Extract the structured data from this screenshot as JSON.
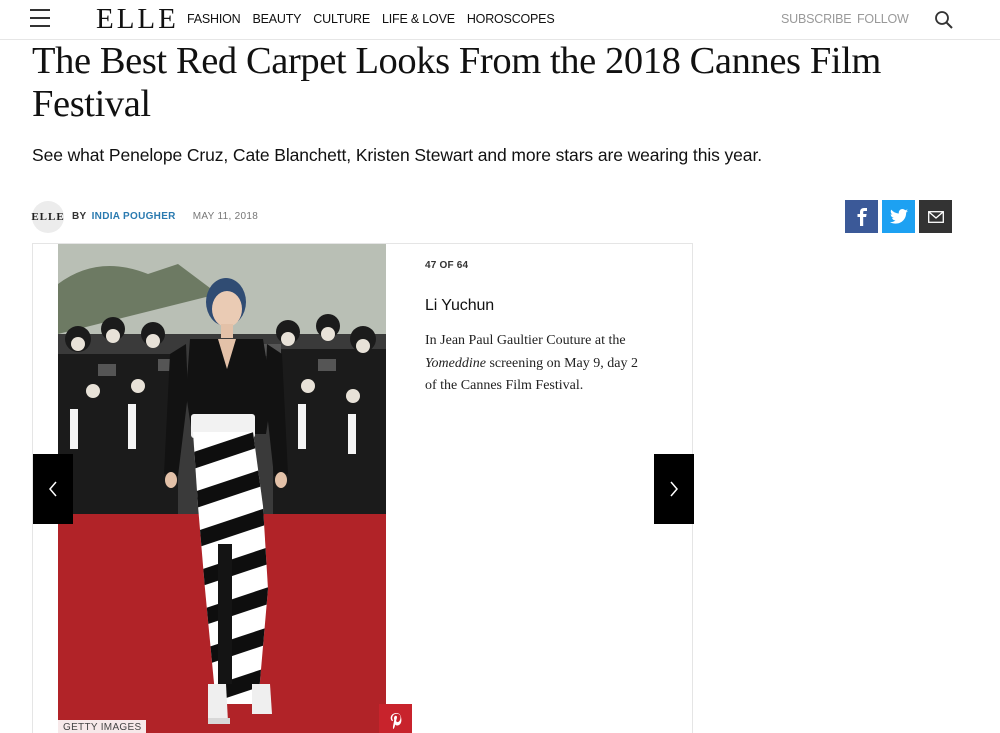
{
  "header": {
    "logo": "ELLE",
    "nav": [
      {
        "label": "FASHION"
      },
      {
        "label": "BEAUTY"
      },
      {
        "label": "CULTURE"
      },
      {
        "label": "LIFE & LOVE"
      },
      {
        "label": "HOROSCOPES"
      }
    ],
    "subscribe_label": "SUBSCRIBE",
    "follow_label": "FOLLOW"
  },
  "article": {
    "title": "The Best Red Carpet Looks From the 2018 Cannes Film Festival",
    "dek": "See what Penelope Cruz, Cate Blanchett, Kristen Stewart and more stars are wearing this year.",
    "avatar_text": "ELLE",
    "by_label": "BY",
    "author": "INDIA POUGHER",
    "date": "MAY 11, 2018"
  },
  "share": {
    "facebook_icon": "facebook-icon",
    "twitter_icon": "twitter-icon",
    "mail_icon": "mail-icon",
    "colors": {
      "facebook": "#3b5998",
      "twitter": "#1da1f2",
      "mail": "#333333"
    }
  },
  "slide": {
    "counter": "47 OF 64",
    "name": "Li Yuchun",
    "caption_pre": "In Jean Paul Gaultier Couture at the ",
    "caption_em": "Yomeddine",
    "caption_post": " screening on May 9, day 2 of the Cannes Film Festival.",
    "credit": "GETTY IMAGES",
    "pin_icon": "pinterest-icon",
    "prev_icon": "chevron-left-icon",
    "next_icon": "chevron-right-icon"
  }
}
